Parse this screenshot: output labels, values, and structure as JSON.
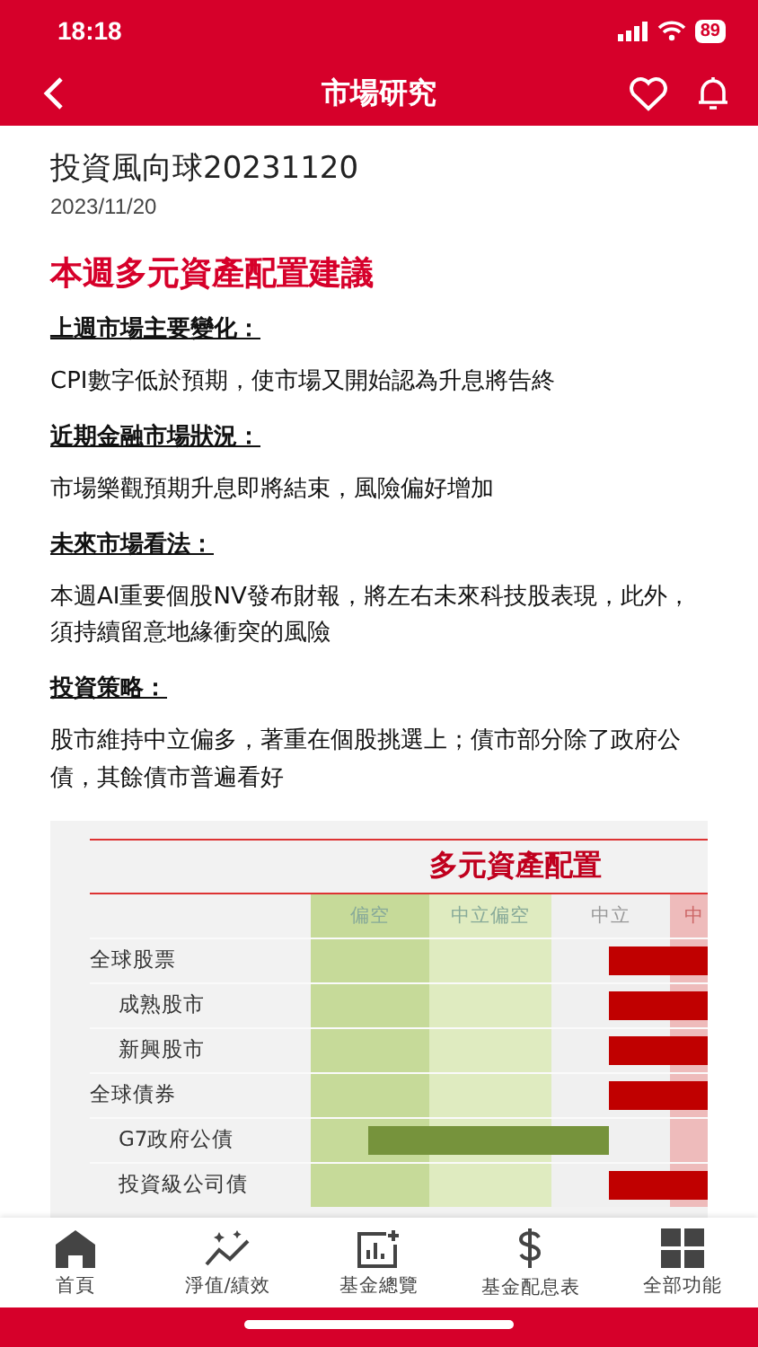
{
  "status_bar": {
    "time": "18:18",
    "battery": "89"
  },
  "nav_bar": {
    "title": "市場研究"
  },
  "article": {
    "title": "投資風向球20231120",
    "date": "2023/11/20",
    "heading": "本週多元資產配置建議",
    "sections": [
      {
        "heading": "上週市場主要變化：",
        "body": "CPI數字低於預期，使市場又開始認為升息將告終"
      },
      {
        "heading": "近期金融市場狀況：",
        "body": "市場樂觀預期升息即將結束，風險偏好增加"
      },
      {
        "heading": "未來市場看法：",
        "body": "本週AI重要個股NV發布財報，將左右未來科技股表現，此外，須持續留意地緣衝突的風險"
      },
      {
        "heading": "投資策略：",
        "body": "股市維持中立偏多，著重在個股挑選上；債市部分除了政府公債，其餘債市普遍看好"
      }
    ]
  },
  "allocation_table": {
    "title": "多元資產配置",
    "columns": [
      "偏空",
      "中立偏空",
      "中立",
      "中"
    ],
    "rows": [
      {
        "label": "全球股票",
        "overweight": true,
        "children": [
          {
            "label": "成熟股市",
            "overweight": true
          },
          {
            "label": "新興股市",
            "overweight": true
          }
        ]
      },
      {
        "label": "全球債券",
        "overweight": true,
        "children": [
          {
            "label": "G7政府公債",
            "overweight": false
          },
          {
            "label": "投資級公司債",
            "overweight": true
          }
        ]
      }
    ]
  },
  "tab_bar": [
    {
      "label": "首頁",
      "kind": "home"
    },
    {
      "label": "淨值/績效",
      "kind": "performance"
    },
    {
      "label": "基金總覽",
      "kind": "overview"
    },
    {
      "label": "基金配息表",
      "kind": "dividend"
    },
    {
      "label": "全部功能",
      "kind": "all"
    }
  ]
}
